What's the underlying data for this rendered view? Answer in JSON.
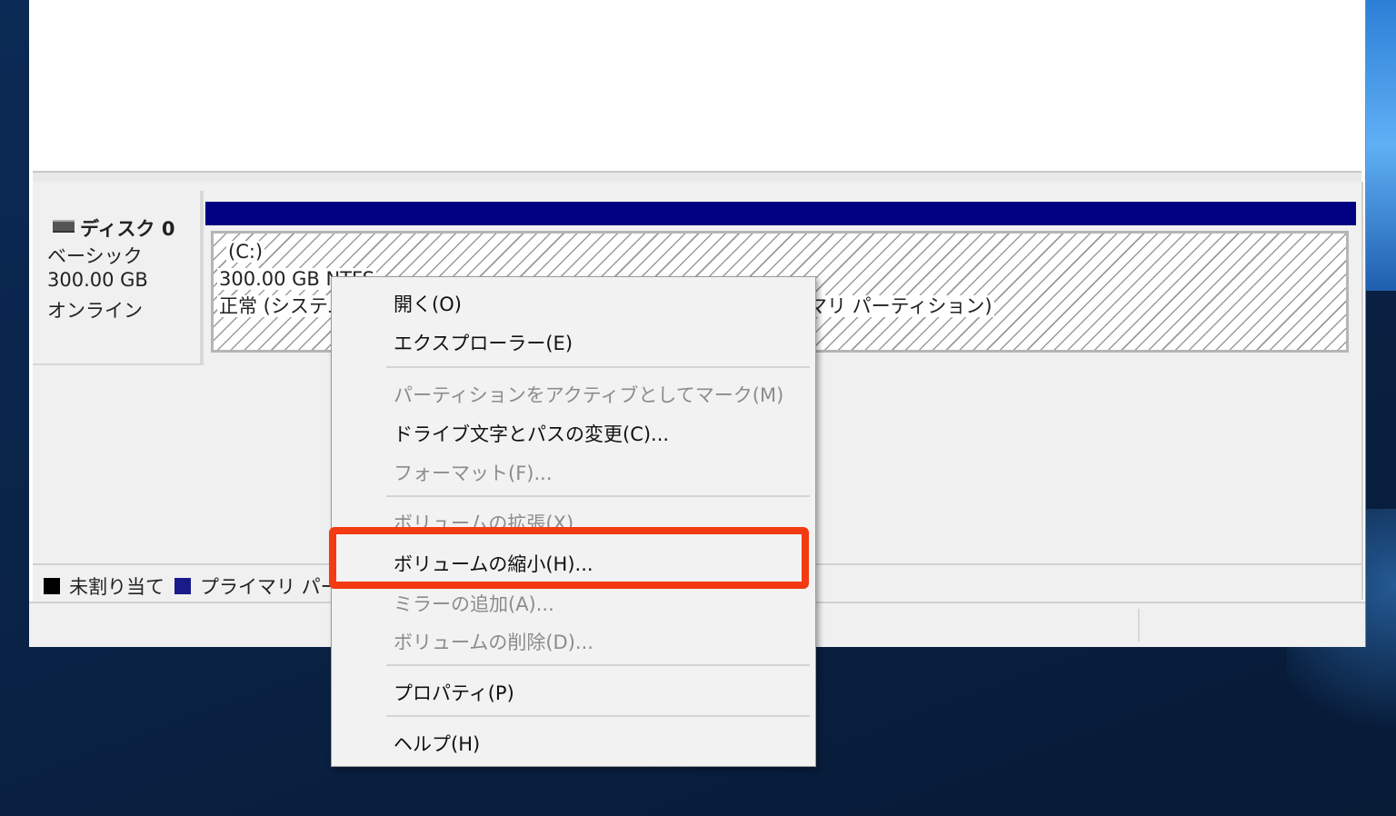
{
  "disk": {
    "name": "ディスク 0",
    "type": "ベーシック",
    "size": "300.00 GB",
    "status": "オンライン"
  },
  "partition": {
    "drive": "(C:)",
    "size_fs": "300.00 GB NTFS",
    "status_start": "正常 (システム",
    "status_end": "マリ パーティション)",
    "header_color": "#000080"
  },
  "legend": {
    "unallocated": "未割り当て",
    "primary": "プライマリ パーテ"
  },
  "context_menu": {
    "items": [
      {
        "label": "開く(O)",
        "enabled": true
      },
      {
        "label": "エクスプローラー(E)",
        "enabled": true
      },
      {
        "label": "パーティションをアクティブとしてマーク(M)",
        "enabled": false
      },
      {
        "label": "ドライブ文字とパスの変更(C)...",
        "enabled": true
      },
      {
        "label": "フォーマット(F)...",
        "enabled": false
      },
      {
        "label": "ボリュームの拡張(X)...",
        "enabled": false
      },
      {
        "label": "ボリュームの縮小(H)...",
        "enabled": true,
        "highlighted": true
      },
      {
        "label": "ミラーの追加(A)...",
        "enabled": false
      },
      {
        "label": "ボリュームの削除(D)...",
        "enabled": false
      },
      {
        "label": "プロパティ(P)",
        "enabled": true
      },
      {
        "label": "ヘルプ(H)",
        "enabled": true
      }
    ],
    "highlight_color": "#f33a12"
  }
}
